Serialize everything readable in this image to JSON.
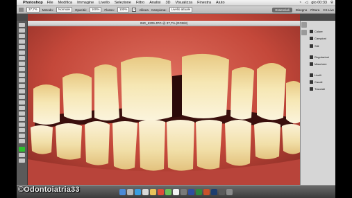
{
  "menubar": {
    "app_name": "Photoshop",
    "items": [
      "File",
      "Modifica",
      "Immagine",
      "Livello",
      "Selezione",
      "Filtro",
      "Analisi",
      "3D",
      "Visualizza",
      "Finestra",
      "Aiuto"
    ],
    "clock": "gio 00:33"
  },
  "options_bar": {
    "zoom": "37,7%",
    "metodo_label": "Metodo:",
    "metodo_value": "Normale",
    "opacita_label": "Opacità:",
    "opacita_value": "100%",
    "flusso_label": "Flusso:",
    "flusso_value": "100%",
    "allinea_label": "Allinea",
    "campiona_label": "Campiona:",
    "campiona_value": "Livello attuale",
    "workspace_essentials": "Essenziali",
    "workspace_disegno": "Disegno",
    "workspace_pittura": "Pittura",
    "cs_live": "CS Live"
  },
  "document": {
    "title": "IMG_6209.JPG @ 37,7% (RGB/8)"
  },
  "panels": {
    "items": [
      "Colore",
      "Campioni",
      "Stili",
      "Regolazioni",
      "Maschere",
      "Livelli",
      "Canali",
      "Tracciati"
    ]
  },
  "watermark": "©Odontoiatria33",
  "colors": {
    "gum": "#c9503f",
    "tooth": "#f3e6b5",
    "panel_bg": "#d6d6d6",
    "toolbar_bg": "#5a5a5a"
  }
}
